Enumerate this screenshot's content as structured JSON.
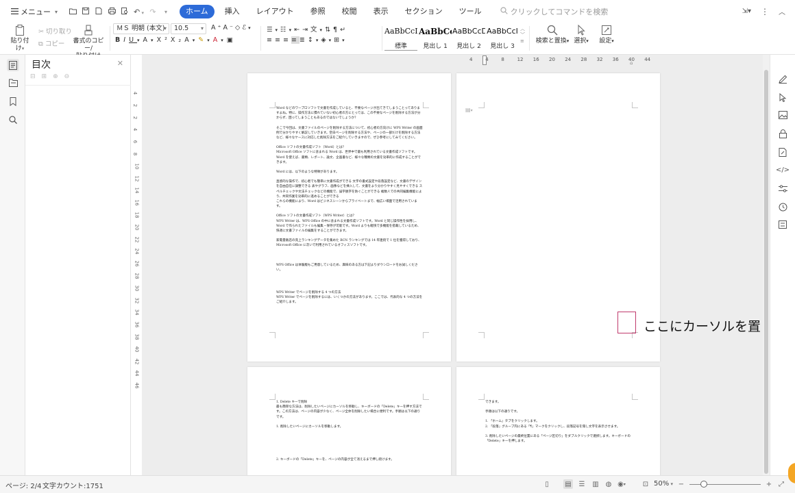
{
  "topbar": {
    "menu_label": "メニュー",
    "tabs": [
      {
        "label": "ホーム",
        "active": true
      },
      {
        "label": "挿入"
      },
      {
        "label": "レイアウト"
      },
      {
        "label": "参照"
      },
      {
        "label": "校閲"
      },
      {
        "label": "表示"
      },
      {
        "label": "セクション"
      },
      {
        "label": "ツール"
      }
    ],
    "command_search_placeholder": "クリックしてコマンドを検索"
  },
  "ribbon": {
    "paste_label": "貼り付け",
    "cut_label": "切り取り",
    "copy_label": "コピー",
    "format_painter_line1": "書式のコピー/",
    "format_painter_line2": "貼り付け",
    "font_name": "ＭＳ 明朝 (本文)",
    "font_size": "10.5",
    "styles": [
      {
        "sample": "AaBbCcD",
        "name": "標準",
        "current": true
      },
      {
        "sample": "AaBbCcI",
        "name": "見出し 1"
      },
      {
        "sample": "AaBbCcD",
        "name": "見出し 2"
      },
      {
        "sample": "AaBbCcI",
        "name": "見出し 3"
      }
    ],
    "find_replace_label": "検索と置換",
    "select_label": "選択",
    "settings_label": "設定"
  },
  "toc": {
    "title": "目次"
  },
  "vruler": {
    "labels": [
      "4",
      "2",
      "2",
      "4",
      "6",
      "8",
      "10",
      "12",
      "14",
      "16",
      "18",
      "20",
      "22",
      "24",
      "26",
      "28",
      "30",
      "32",
      "34",
      "36",
      "38",
      "40",
      "42",
      "44",
      "46"
    ]
  },
  "hruler": {
    "labels": [
      "4",
      "4",
      "8",
      "12",
      "16",
      "20",
      "24",
      "28",
      "32",
      "36",
      "40",
      "44"
    ]
  },
  "pages": {
    "page1": {
      "paragraphs": [
        "Word などのワープロソフトで文書を作成していると、不要なページが出てきてしまうことってありますよね。特に、操作方法に慣れていない初心者の方にとっては、この不要なページを削除する方法が分からず、困ってしまうこともあるのではないでしょうか？",
        "そこで今回は、文書ファイルのページを削除する方法について、初心者の方向けに WPS Writer の画面例で分かりやすく解説していきます。空白ページを削除する方法や、ページの一部だけを削除する方法など、様々なケースに対応した削除方法をご紹介していきますので、ぜひ参考にしてみてください。",
        "Office ソフトの文書作成ソフト（Word）とは？\nMicrosoft Office ソフトに含まれる Word は、世界中で最も利用されている文書作成ソフトです。Word を使えば、書類、レポート、論文、企画書など、様々な種類の文書を効率的に作成することができます。",
        "Word には、以下のような特徴があります。",
        "直感的な操作で、初心者でも簡単に文書作成ができる 文字の書式設定や段落設定など、文書のデザインを自由自在に調整できる 表やグラフ、画像などを挿入して、文書をより分かりやすく見やすくできる スペルチェックや文法チェックなどの機能で、誤字脱字を防ぐことができる 複数人での共同編集機能により、共同作業を効率的に進めることができる\nこれらの機能により、Word はビジネスシーンからプライベートまで、幅広い場面で活用されています。",
        "Office ソフトの文書作成ソフト（WPS Writer）とは？\nWPS Writer は、WPS Office の中に含まれる文書作成ソフトです。Word と同じ操作性を採用し、Word で作られたファイルも編集・保存が可能です。Word よりも軽快で多機能を搭載しているため、快適に文書ファイルの編集をすることができます。",
        "家電量販店の売上ランキングデータを集めた BCN ランキングでは 14 年連続で 1 位を獲得しており、Microsoft Office に次いで利用されているオフィスソフトです。",
        "WPS Office は体験版もご用意しているため、興味のある方は下記よりダウンロードをお試しください。",
        "WPS Writer でページを削除する 4 つの方法\nWPS Writer でページを削除するには、いくつかの方法があります。ここでは、代表的な 4 つの方法をご紹介します。"
      ]
    },
    "page3": {
      "paragraphs": [
        "1. Delete キーで削除\n最も簡単な方法は、削除したいページにカーソルを移動し、キーボードの「Delete」キーを押す方法です。この方法は、ページの内容が少なく、ページ全体を削除したい場合に便利です。手順は以下の通りです。",
        "1. 削除したいページにカーソルを移動します。",
        "2. キーボードの「Delete」キーを、ページの内容が全て消えるまで押し続けます。"
      ]
    },
    "page4": {
      "paragraphs": [
        "できます。",
        "手順は以下の通りです。",
        "1. 「ホーム」タブをクリックします。\n2. 「段落」グループ内にある「¶」マークをクリックし、段落記号を隠し文字を表示させます。",
        "3. 削除したいページの最終位置にある「ページ区切り」をダブルクリックで選択します。キーボードの「Delete」キーを押します。"
      ]
    }
  },
  "annotation": {
    "text": "ここにカーソルを置く",
    "color": "#c0396b"
  },
  "status": {
    "page": "ページ: 2/4",
    "word_count": "文字カウント:1751",
    "zoom": "50%",
    "zoom_level": 0.2
  },
  "colors": {
    "accent": "#2d6bd8",
    "canvas": "#ededed"
  }
}
